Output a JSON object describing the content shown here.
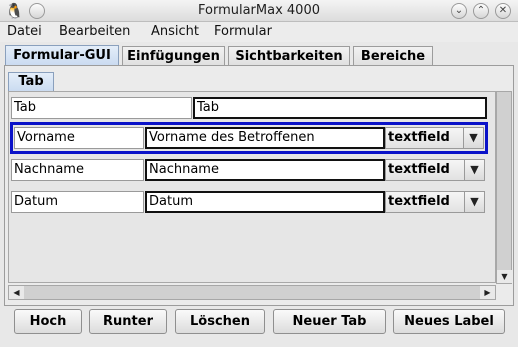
{
  "window": {
    "title": "FormularMax 4000",
    "icon": "penguin-icon",
    "controls": {
      "minimize": "⌄",
      "maximize": "⌃",
      "close": "✕"
    }
  },
  "menu": [
    "Datei",
    "Bearbeiten",
    "Ansicht",
    "Formular"
  ],
  "tabs": [
    {
      "label": "Formular-GUI",
      "active": true
    },
    {
      "label": "Einfügungen",
      "active": false
    },
    {
      "label": "Sichtbarkeiten",
      "active": false
    },
    {
      "label": "Bereiche",
      "active": false
    }
  ],
  "inner_tab": {
    "label": "Tab"
  },
  "rows": [
    {
      "label": "Tab",
      "value": "Tab",
      "type": ""
    },
    {
      "label": "Vorname",
      "value": "Vorname des Betroffenen",
      "type": "textfield",
      "selected": true
    },
    {
      "label": "Nachname",
      "value": "Nachname",
      "type": "textfield"
    },
    {
      "label": "Datum",
      "value": "Datum",
      "type": "textfield"
    }
  ],
  "buttons": {
    "up": "Hoch",
    "down": "Runter",
    "delete": "Löschen",
    "new_tab": "Neuer Tab",
    "new_label": "Neues Label"
  },
  "colors": {
    "selection_border": "#0a12c8",
    "active_tab": "#c9daf0"
  }
}
